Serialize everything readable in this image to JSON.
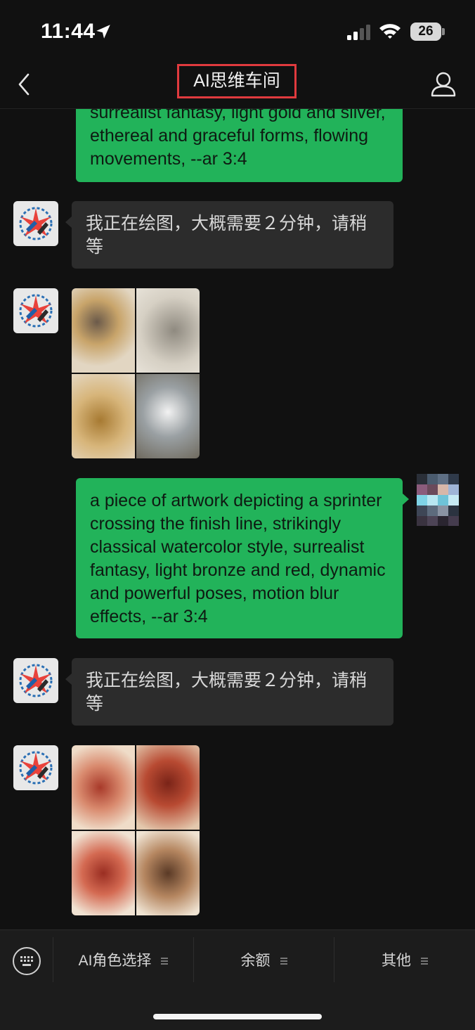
{
  "status_bar": {
    "time": "11:44",
    "battery": "26"
  },
  "nav": {
    "title": "AI思维车间"
  },
  "messages": {
    "m1": {
      "text": "surrealist fantasy, light gold and silver, ethereal and graceful forms, flowing movements, --ar 3:4"
    },
    "m2": {
      "text": "我正在绘图，大概需要２分钟，请稍等"
    },
    "m4": {
      "text": "a piece of artwork depicting a sprinter crossing the finish line, strikingly classical watercolor style, surrealist fantasy, light bronze and red, dynamic and powerful poses, motion blur effects, --ar 3:4"
    },
    "m5": {
      "text": "我正在绘图，大概需要２分钟，请稍等"
    }
  },
  "bottom_menu": {
    "items": [
      {
        "label": "AI角色选择"
      },
      {
        "label": "余额"
      },
      {
        "label": "其他"
      }
    ]
  },
  "colors": {
    "accent_green": "#22b35a",
    "title_highlight": "#e03a3e"
  }
}
